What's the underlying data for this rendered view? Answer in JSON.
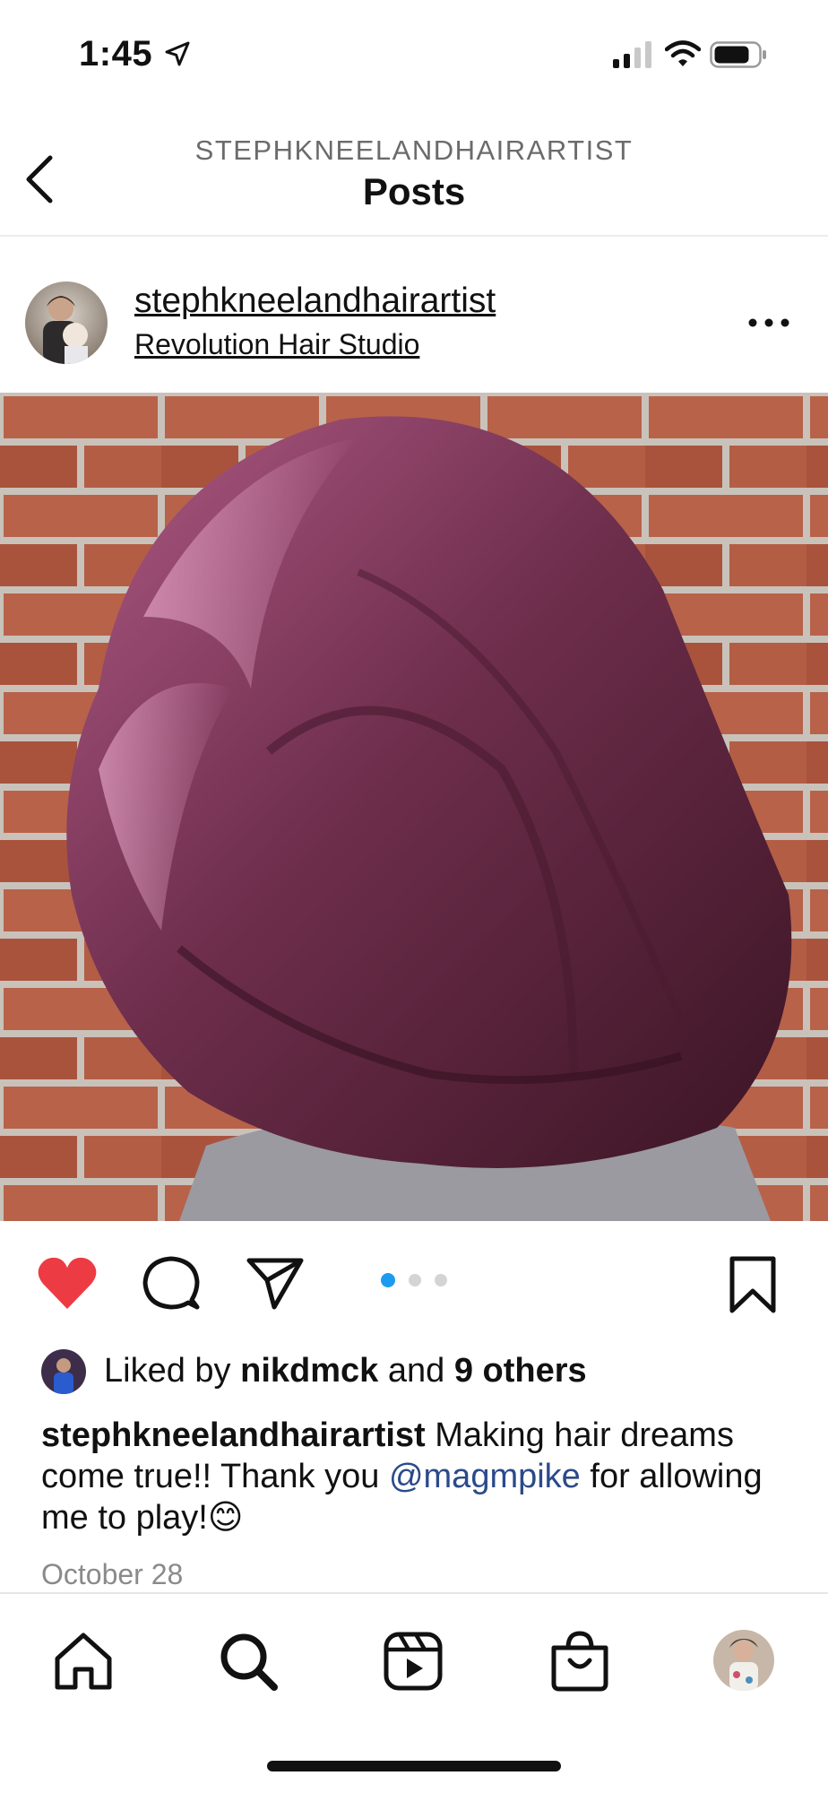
{
  "status_bar": {
    "time": "1:45"
  },
  "header": {
    "account": "STEPHKNEELANDHAIRARTIST",
    "title": "Posts"
  },
  "post": {
    "username": "stephkneelandhairartist",
    "location": "Revolution Hair Studio",
    "liked": true,
    "carousel": {
      "total": 3,
      "current": 1,
      "active_color": "#1d9bf0"
    },
    "likes": {
      "prefix": "Liked by",
      "liker": "nikdmck",
      "joiner": "and",
      "others": "9 others"
    },
    "caption": {
      "username": "stephkneelandhairartist",
      "text_before": "Making hair dreams come true!! Thank you",
      "mention": "@magmpike",
      "text_after": "for allowing me to play!😊"
    },
    "date": "October 28"
  },
  "colors": {
    "like_red": "#ed3b44",
    "mention": "#2b4a8a"
  },
  "tabs": [
    "home-icon",
    "search-icon",
    "reels-icon",
    "shop-icon",
    "profile-avatar"
  ]
}
